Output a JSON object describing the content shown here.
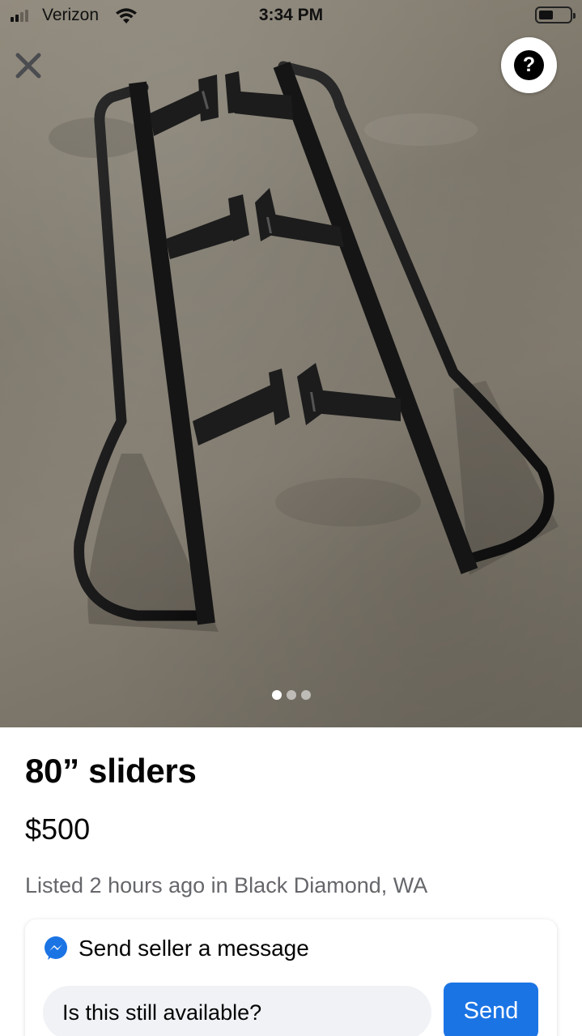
{
  "status_bar": {
    "carrier": "Verizon",
    "time": "3:34 PM",
    "signal_bars_active": 2,
    "signal_bars_total": 4
  },
  "photo": {
    "subject": "black steel rock sliders on concrete floor",
    "image_count": 3,
    "active_index": 0
  },
  "icons": {
    "close": "close-icon",
    "help": "question-mark-icon",
    "messenger": "messenger-icon",
    "wifi": "wifi-icon",
    "battery": "battery-icon"
  },
  "listing": {
    "title": "80” sliders",
    "price": "$500",
    "meta": "Listed 2 hours ago in Black Diamond, WA"
  },
  "message": {
    "header": "Send seller a message",
    "input_value": "Is this still available?",
    "send_label": "Send"
  },
  "colors": {
    "accent": "#1b74e4",
    "secondary_text": "#65676b",
    "input_bg": "#f0f2f5"
  }
}
